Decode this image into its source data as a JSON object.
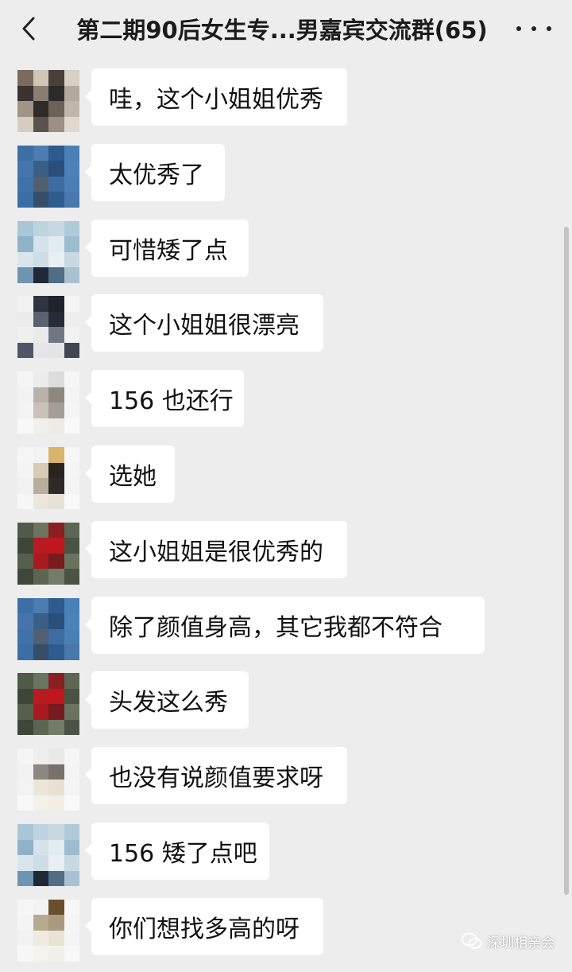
{
  "header": {
    "title": "第二期90后女生专...男嘉宾交流群(65)",
    "back_icon": "chevron-left-icon",
    "more_icon": "ellipsis-icon"
  },
  "messages": [
    {
      "text": "哇，这个小姐姐优秀",
      "avatar_colors": [
        "#7b6b5e",
        "#cfc6b8",
        "#4a3f39",
        "#d8d0c4",
        "#3a3330",
        "#8a7d72",
        "#2d2a2a",
        "#b4a99e",
        "#a19387",
        "#2f2b2b",
        "#6d625a",
        "#c0b6ab",
        "#d6cdc2",
        "#5b524d",
        "#9d8f83",
        "#e0d8cf"
      ]
    },
    {
      "text": "太优秀了",
      "avatar_colors": [
        "#3d6fa6",
        "#4b7db3",
        "#2e5a8e",
        "#4a80b8",
        "#4675ab",
        "#3a5f86",
        "#2b4f7d",
        "#4c82ba",
        "#3f72a8",
        "#506070",
        "#3c6da2",
        "#4a7fb6",
        "#3b6ea4",
        "#354f6a",
        "#2f5c8f",
        "#4878ad"
      ]
    },
    {
      "text": "可惜矮了点",
      "avatar_colors": [
        "#a9c6d8",
        "#bed3e0",
        "#c7d8e2",
        "#b0cad9",
        "#8fb2c8",
        "#d5e2ea",
        "#e2ebf0",
        "#9cbccf",
        "#d9e5ec",
        "#cfdde6",
        "#e8eff3",
        "#c9d9e3",
        "#6e95b2",
        "#1f2a36",
        "#516e86",
        "#a8c2d3"
      ]
    },
    {
      "text": "这个小姐姐很漂亮",
      "avatar_colors": [
        "#f2f2f2",
        "#2f3540",
        "#1e232c",
        "#f5f5f5",
        "#ececec",
        "#5a6272",
        "#262b35",
        "#eeeeee",
        "#f0f0f0",
        "#eaeaea",
        "#707784",
        "#f2f2f2",
        "#4f5666",
        "#e6e6e6",
        "#e4e4e4",
        "#3f4654"
      ]
    },
    {
      "text": "156 也还行",
      "avatar_colors": [
        "#f5f5f5",
        "#ececec",
        "#dcdcdc",
        "#f6f6f6",
        "#f2f2f2",
        "#b9b2aa",
        "#8f8880",
        "#f4f4f4",
        "#f3f3f3",
        "#c8c2ba",
        "#a59e96",
        "#f5f5f5",
        "#f8f8f8",
        "#f1efe9",
        "#eeebe4",
        "#f9f9f9"
      ]
    },
    {
      "text": "选她",
      "avatar_colors": [
        "#f6f6f6",
        "#f3f3f3",
        "#d9b46a",
        "#f7f7f7",
        "#f4f4f4",
        "#d7cbb6",
        "#2a2320",
        "#f5f5f5",
        "#f2f2f2",
        "#b8ae9e",
        "#2f2a27",
        "#f4f4f4",
        "#f7f7f7",
        "#ece7dd",
        "#e7e2d8",
        "#f8f8f8"
      ]
    },
    {
      "text": "这小姐姐是很优秀的",
      "avatar_colors": [
        "#4f5a48",
        "#6a7460",
        "#8a1f22",
        "#5d6653",
        "#3e4638",
        "#b81c22",
        "#c0161d",
        "#4a5343",
        "#565f4b",
        "#a81a20",
        "#771b1f",
        "#6a735e",
        "#3f463a",
        "#5c6551",
        "#737c68",
        "#4b5344"
      ]
    },
    {
      "text": "除了颜值身高，其它我都不符合",
      "avatar_colors": [
        "#3d6fa6",
        "#4b7db3",
        "#2e5a8e",
        "#4a80b8",
        "#4675ab",
        "#3a5f86",
        "#2b4f7d",
        "#4c82ba",
        "#3f72a8",
        "#506070",
        "#3c6da2",
        "#4a7fb6",
        "#3b6ea4",
        "#354f6a",
        "#2f5c8f",
        "#4878ad"
      ]
    },
    {
      "text": "头发这么秀",
      "avatar_colors": [
        "#4f5a48",
        "#6a7460",
        "#8a1f22",
        "#5d6653",
        "#3e4638",
        "#b81c22",
        "#c0161d",
        "#4a5343",
        "#565f4b",
        "#a81a20",
        "#771b1f",
        "#6a735e",
        "#3f463a",
        "#5c6551",
        "#737c68",
        "#4b5344"
      ]
    },
    {
      "text": "也没有说颜值要求呀",
      "avatar_colors": [
        "#f5f5f5",
        "#eeeeee",
        "#e9e9e9",
        "#f6f6f6",
        "#f2f2f2",
        "#8c8782",
        "#77716c",
        "#f4f4f4",
        "#f3f3f3",
        "#ece6da",
        "#e8e1d3",
        "#f5f5f5",
        "#f8f8f8",
        "#f4f1ea",
        "#f2eee6",
        "#f9f9f9"
      ]
    },
    {
      "text": "156 矮了点吧",
      "avatar_colors": [
        "#a9c6d8",
        "#bed3e0",
        "#c7d8e2",
        "#b0cad9",
        "#8fb2c8",
        "#d5e2ea",
        "#e2ebf0",
        "#9cbccf",
        "#d9e5ec",
        "#cfdde6",
        "#e8eff3",
        "#c9d9e3",
        "#6e95b2",
        "#1f2a36",
        "#516e86",
        "#a8c2d3"
      ]
    },
    {
      "text": "你们想找多高的呀",
      "avatar_colors": [
        "#f6f6f6",
        "#f3f3f3",
        "#6a4f2f",
        "#f7f7f7",
        "#f4f4f4",
        "#b8aa8e",
        "#a89a80",
        "#f5f5f5",
        "#f2f2f2",
        "#efebe2",
        "#e9e3d5",
        "#f4f4f4",
        "#f7f7f7",
        "#f5f3ee",
        "#f3f0ea",
        "#f8f8f8"
      ]
    }
  ],
  "watermark": {
    "text": "深圳相亲会",
    "icon": "wechat-logo-icon"
  },
  "colors": {
    "background": "#ededed",
    "bubble": "#ffffff",
    "text": "#111111"
  }
}
